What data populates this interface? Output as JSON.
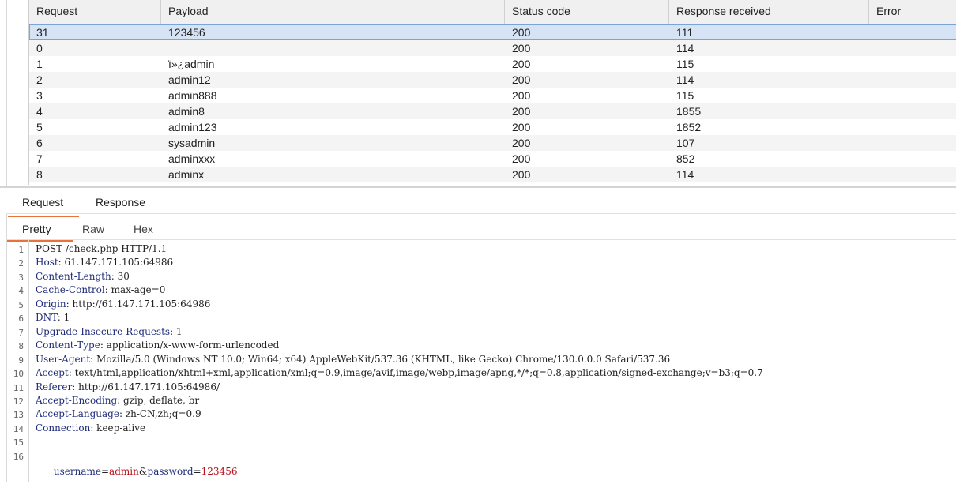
{
  "table": {
    "columns": [
      "Request",
      "Payload",
      "Status code",
      "Response received",
      "Error"
    ],
    "rows": [
      {
        "request": "31",
        "payload": "123456",
        "status": "200",
        "received": "111",
        "error": ""
      },
      {
        "request": "0",
        "payload": "",
        "status": "200",
        "received": "114",
        "error": ""
      },
      {
        "request": "1",
        "payload": "ï»¿admin",
        "status": "200",
        "received": "115",
        "error": ""
      },
      {
        "request": "2",
        "payload": "admin12",
        "status": "200",
        "received": "114",
        "error": ""
      },
      {
        "request": "3",
        "payload": "admin888",
        "status": "200",
        "received": "115",
        "error": ""
      },
      {
        "request": "4",
        "payload": "admin8",
        "status": "200",
        "received": "1855",
        "error": ""
      },
      {
        "request": "5",
        "payload": "admin123",
        "status": "200",
        "received": "1852",
        "error": ""
      },
      {
        "request": "6",
        "payload": "sysadmin",
        "status": "200",
        "received": "107",
        "error": ""
      },
      {
        "request": "7",
        "payload": "adminxxx",
        "status": "200",
        "received": "852",
        "error": ""
      },
      {
        "request": "8",
        "payload": "adminx",
        "status": "200",
        "received": "114",
        "error": ""
      }
    ]
  },
  "tabs": {
    "request": "Request",
    "response": "Response"
  },
  "subtabs": {
    "pretty": "Pretty",
    "raw": "Raw",
    "hex": "Hex"
  },
  "editor": {
    "line_numbers": [
      "1",
      "2",
      "3",
      "4",
      "5",
      "6",
      "7",
      "8",
      "9",
      "10",
      "11",
      "12",
      "13",
      "14",
      "15",
      "16"
    ],
    "request_line": "POST /check.php HTTP/1.1",
    "headers": [
      {
        "key": "Host",
        "value": "61.147.171.105:64986"
      },
      {
        "key": "Content-Length",
        "value": "30"
      },
      {
        "key": "Cache-Control",
        "value": "max-age=0"
      },
      {
        "key": "Origin",
        "value": "http://61.147.171.105:64986"
      },
      {
        "key": "DNT",
        "value": "1"
      },
      {
        "key": "Upgrade-Insecure-Requests",
        "value": "1"
      },
      {
        "key": "Content-Type",
        "value": "application/x-www-form-urlencoded"
      },
      {
        "key": "User-Agent",
        "value": "Mozilla/5.0 (Windows NT 10.0; Win64; x64) AppleWebKit/537.36 (KHTML, like Gecko) Chrome/130.0.0.0 Safari/537.36"
      },
      {
        "key": "Accept",
        "value": "text/html,application/xhtml+xml,application/xml;q=0.9,image/avif,image/webp,image/apng,*/*;q=0.8,application/signed-exchange;v=b3;q=0.7"
      },
      {
        "key": "Referer",
        "value": "http://61.147.171.105:64986/"
      },
      {
        "key": "Accept-Encoding",
        "value": "gzip, deflate, br"
      },
      {
        "key": "Accept-Language",
        "value": "zh-CN,zh;q=0.9"
      },
      {
        "key": "Connection",
        "value": "keep-alive"
      }
    ],
    "body": {
      "param1_key": "username",
      "param1_value": "admin",
      "param2_key": "password",
      "param2_value": "123456",
      "eq": "=",
      "amp": "&"
    }
  }
}
